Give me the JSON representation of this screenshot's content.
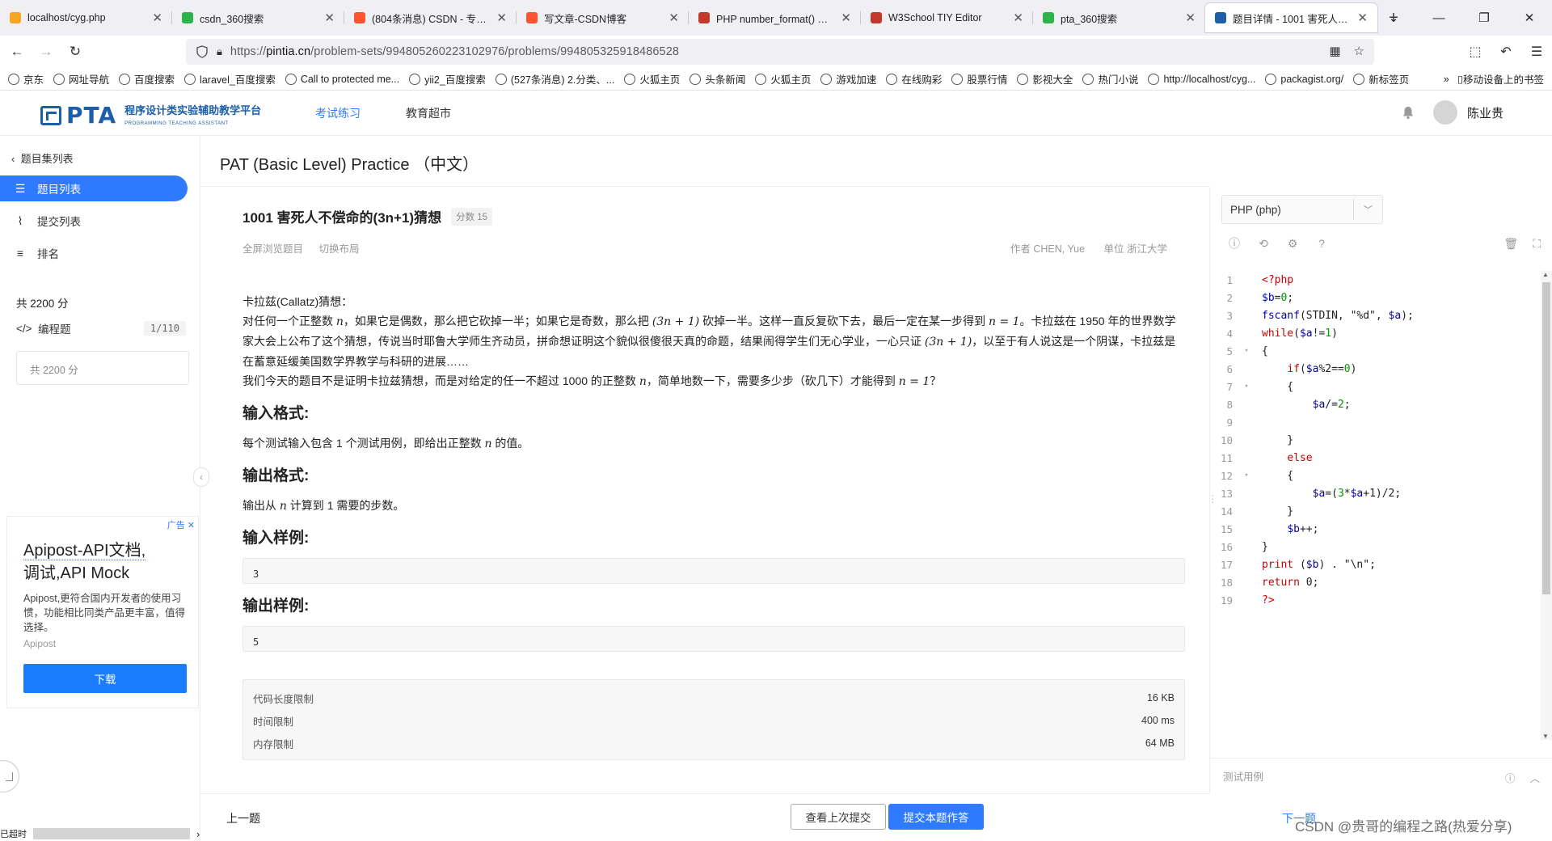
{
  "browser": {
    "tabs": [
      {
        "title": "localhost/cyg.php",
        "color": "#f5a623",
        "active": false
      },
      {
        "title": "csdn_360搜索",
        "color": "#2cb34a",
        "active": false
      },
      {
        "title": "(804条消息) CSDN - 专业开发",
        "color": "#fc5531",
        "active": false
      },
      {
        "title": "写文章-CSDN博客",
        "color": "#fc5531",
        "active": false
      },
      {
        "title": "PHP number_format() 函数",
        "color": "#c0392b",
        "active": false
      },
      {
        "title": "W3School TIY Editor",
        "color": "#c0392b",
        "active": false
      },
      {
        "title": "pta_360搜索",
        "color": "#2cb34a",
        "active": false
      },
      {
        "title": "题目详情 - 1001 害死人不偿",
        "color": "#1c5fa8",
        "active": true
      }
    ],
    "url_prefix": "https://",
    "url_host": "pintia.cn",
    "url_path": "/problem-sets/994805260223102976/problems/994805325918486528",
    "bookmarks": [
      "京东",
      "网址导航",
      "百度搜索",
      "laravel_百度搜索",
      "Call to protected me...",
      "yii2_百度搜索",
      "(527条消息) 2.分类、...",
      "火狐主页",
      "头条新闻",
      "火狐主页",
      "游戏加速",
      "在线购彩",
      "股票行情",
      "影视大全",
      "热门小说",
      "http://localhost/cyg...",
      "packagist.org/",
      "新标签页"
    ],
    "bookmarks_more": "移动设备上的书签"
  },
  "header": {
    "logo_text": "PTA",
    "logo_cn": "程序设计类实验辅助教学平台",
    "logo_en": "PROGRAMMING TEACHING ASSISTANT",
    "nav": [
      {
        "label": "考试练习",
        "active": true
      },
      {
        "label": "教育超市",
        "active": false
      }
    ],
    "username": "陈业贵"
  },
  "sidebar": {
    "back": "题目集列表",
    "items": [
      {
        "label": "题目列表",
        "icon": "list-icon",
        "active": true
      },
      {
        "label": "提交列表",
        "icon": "pulse-icon",
        "active": false
      },
      {
        "label": "排名",
        "icon": "ranking-icon",
        "active": false
      }
    ],
    "total": "共 2200 分",
    "prog_label": "编程题",
    "prog_count": "1/110",
    "box_text": "共 2200 分",
    "timeout": "已超时"
  },
  "ad": {
    "tag": "广告",
    "title_a": "Apipost-API文档,",
    "title_b": "调试,API Mock",
    "desc": "Apipost,更符合国内开发者的使用习惯，功能相比同类产品更丰富，值得选择。",
    "brand": "Apipost",
    "button": "下载"
  },
  "main": {
    "set_title": "PAT (Basic Level) Practice （中文）",
    "problem_title": "1001 害死人不偿命的(3n+1)猜想",
    "score": "分数 15",
    "meta_fullscreen": "全屏浏览题目",
    "meta_layout": "切换布局",
    "author": "作者 CHEN, Yue",
    "unit": "单位 浙江大学",
    "p_intro": "卡拉兹(Callatz)猜想：",
    "p1_a": "对任何一个正整数 ",
    "p1_n": "n",
    "p1_b": "，如果它是偶数，那么把它砍掉一半；如果它是奇数，那么把 ",
    "p1_m1": "(3n + 1)",
    "p1_c": " 砍掉一半。这样一直反复砍下去，最后一定在某一步得到 ",
    "p1_m2": "n = 1",
    "p1_d": "。卡拉兹在 1950 年的世界数学家大会上公布了这个猜想，传说当时耶鲁大学师生齐动员，拼命想证明这个貌似很傻很天真的命题，结果闹得学生们无心学业，一心只证 ",
    "p1_m3": "(3n + 1)",
    "p1_e": "，以至于有人说这是一个阴谋，卡拉兹是在蓄意延缓美国数学界教学与科研的进展……",
    "p2_a": "我们今天的题目不是证明卡拉兹猜想，而是对给定的任一不超过 1000 的正整数 ",
    "p2_n": "n",
    "p2_b": "，简单地数一下，需要多少步（砍几下）才能得到 ",
    "p2_m": "n = 1",
    "p2_c": "？",
    "h_input": "输入格式:",
    "input_a": "每个测试输入包含 1 个测试用例，即给出正整数 ",
    "input_n": "n",
    "input_b": " 的值。",
    "h_output": "输出格式:",
    "output_a": "输出从 ",
    "output_n": "n",
    "output_b": " 计算到 1 需要的步数。",
    "h_sample_in": "输入样例:",
    "sample_in": "3",
    "h_sample_out": "输出样例:",
    "sample_out": "5",
    "limits": [
      {
        "label": "代码长度限制",
        "value": "16 KB"
      },
      {
        "label": "时间限制",
        "value": "400 ms"
      },
      {
        "label": "内存限制",
        "value": "64 MB"
      }
    ],
    "prev": "上一题",
    "next": "下一题",
    "btn_history": "查看上次提交",
    "btn_submit": "提交本题作答"
  },
  "editor": {
    "language": "PHP (php)",
    "testcase": "测试用例",
    "lines": [
      "<?php",
      "$b=0;",
      "fscanf(STDIN, \"%d\", $a);",
      "while($a!=1)",
      "{",
      "\t\tif($a%2==0)",
      "\t\t{",
      "\t\t\t\t$a/=2;",
      "\t\t\t\t",
      "\t\t}",
      "\t\telse",
      "\t\t{",
      "\t\t\t\t$a=(3*$a+1)/2;",
      "\t\t}",
      "\t\t$b++;",
      "}",
      "print ($b) . \"\\n\";",
      "return 0;",
      "?>"
    ],
    "fold_lines": [
      5,
      7,
      12
    ]
  },
  "watermark": "CSDN @贵哥的编程之路(热爱分享)"
}
